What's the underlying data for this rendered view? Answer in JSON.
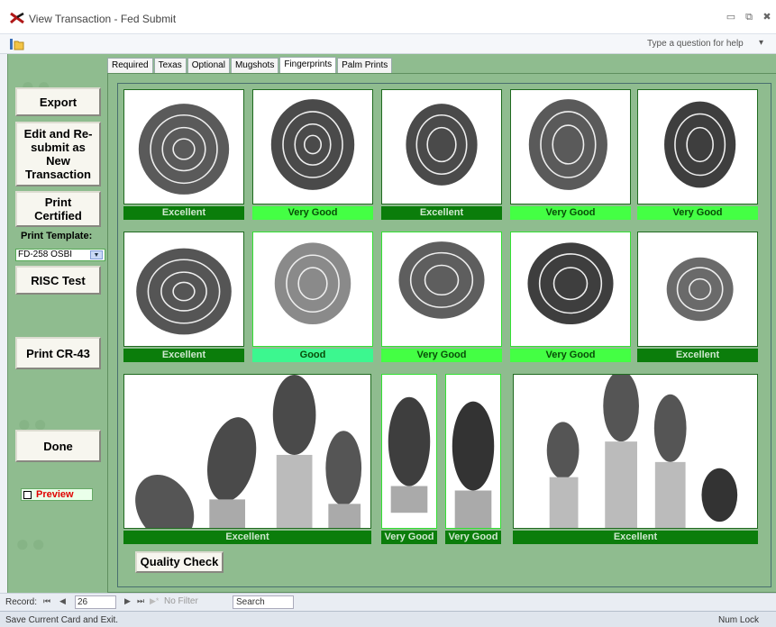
{
  "window": {
    "title": "View Transaction - Fed Submit"
  },
  "toolbar": {
    "help_placeholder": "Type a question for help"
  },
  "tabs": [
    {
      "label": "Required",
      "active": false
    },
    {
      "label": "Texas",
      "active": false
    },
    {
      "label": "Optional",
      "active": false
    },
    {
      "label": "Mugshots",
      "active": false
    },
    {
      "label": "Fingerprints",
      "active": true
    },
    {
      "label": "Palm Prints",
      "active": false
    }
  ],
  "left_panel": {
    "export": "Export",
    "edit_resubmit": "Edit and Re-submit as New Transaction",
    "print_certified": "Print Certified",
    "print_template_label": "Print Template:",
    "print_template_value": "FD-258 OSBI",
    "risc_test": "RISC Test",
    "print_cr43": "Print CR-43",
    "done": "Done",
    "preview_label": "Preview"
  },
  "grades": {
    "row1": [
      "Excellent",
      "Very Good",
      "Excellent",
      "Very Good",
      "Very Good"
    ],
    "row2": [
      "Excellent",
      "Good",
      "Very Good",
      "Very Good",
      "Excellent"
    ],
    "row3": [
      "Excellent",
      "Very Good",
      "Very Good",
      "Excellent"
    ]
  },
  "quality_check": "Quality Check",
  "record_nav": {
    "label": "Record:",
    "current": "26",
    "filter": "No Filter",
    "search": "Search"
  },
  "status": {
    "message": "Save Current Card and Exit.",
    "num_lock": "Num Lock"
  },
  "colors": {
    "form_bg": "#8fbc8f",
    "grade_dark": "#0b7d0b",
    "grade_light": "#44ff44",
    "grade_good": "#3cf78f",
    "preview_text": "#e00000"
  }
}
